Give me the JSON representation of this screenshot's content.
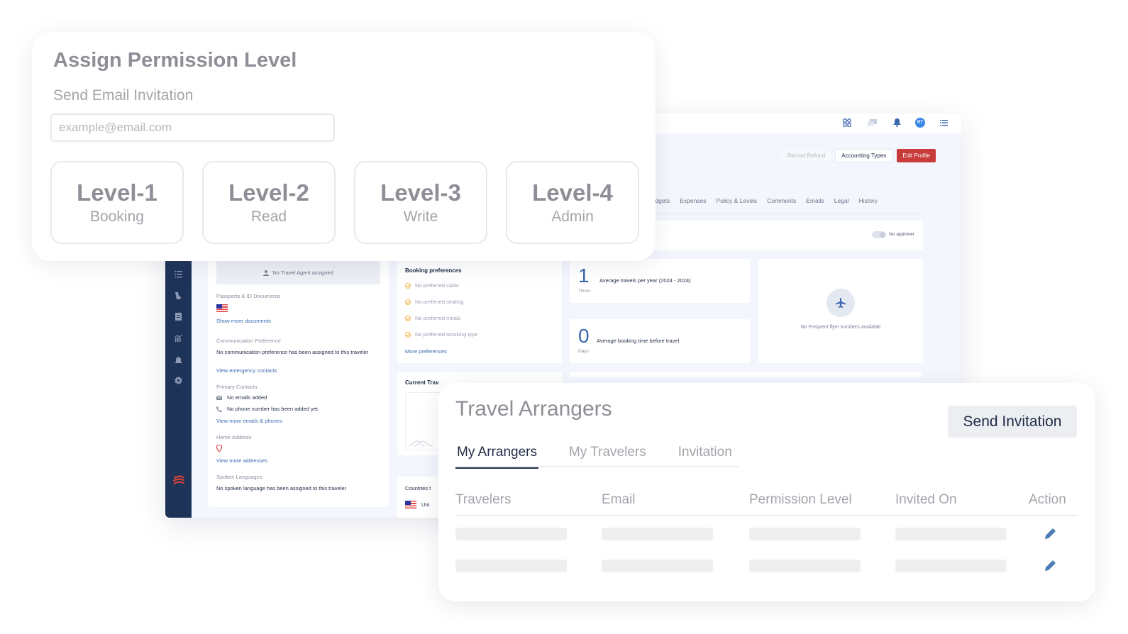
{
  "dashboard": {
    "topbar_icons": [
      "apps-grid-icon",
      "chat-icon",
      "bell-icon",
      "avatar",
      "menu-list-icon"
    ],
    "avatar_initials": "RT",
    "buttons": {
      "record_refund": "Record Refund",
      "accounting_types": "Accounting Types",
      "edit_profile": "Edit Profile"
    },
    "tabs": [
      "Budgets",
      "Expenses",
      "Policy & Levels",
      "Comments",
      "Emails",
      "Legal",
      "History"
    ],
    "approver_label": "No approver",
    "sidebar_icons": [
      "policy-icon",
      "checklist-icon",
      "booking-icon",
      "invoice-icon",
      "analytics-icon",
      "alert-icon",
      "settings-icon"
    ],
    "profile": {
      "travel_agent": "No Travel Agent assigned",
      "passports_label": "Passports & ID Documents",
      "show_more_documents": "Show more documents",
      "communication_label": "Communication Preference",
      "communication_text": "No communication preference has been assigned to this traveler",
      "emergency_link": "View emergency contacts",
      "primary_contacts_label": "Primary Contacts",
      "no_emails": "No emails added",
      "no_phone": "No phone number has been added yet.",
      "view_emails_phones": "View more emails & phones",
      "home_address_label": "Home Address",
      "view_addresses": "View more addresses",
      "spoken_languages_label": "Spoken Languages",
      "spoken_languages_text": "No spoken language has been assigned to this traveler"
    },
    "booking_preferences": {
      "title": "Booking preferences",
      "items": [
        "No preferred cabin",
        "No preferred seating",
        "No preferred meals",
        "No preferred smoking type"
      ],
      "more_link": "More preferences"
    },
    "stats": [
      {
        "value": "1",
        "unit": "Times",
        "label": "Average travels per year (2024 - 2024)"
      },
      {
        "value": "0",
        "unit": "Days",
        "label": "Average booking time before travel"
      }
    ],
    "frequent_flyer_text": "No Frequent flyer numbers available",
    "current_travels_title": "Current Trav",
    "countries_title": "Countries t",
    "countries_item": "Uni"
  },
  "permission_panel": {
    "title": "Assign Permission Level",
    "subtitle": "Send Email Invitation",
    "email_placeholder": "example@email.com",
    "email_value": "",
    "levels": [
      {
        "name": "Level-1",
        "desc": "Booking"
      },
      {
        "name": "Level-2",
        "desc": "Read"
      },
      {
        "name": "Level-3",
        "desc": "Write"
      },
      {
        "name": "Level-4",
        "desc": "Admin"
      }
    ]
  },
  "arrangers_panel": {
    "title": "Travel Arrangers",
    "send_invitation": "Send Invitation",
    "tabs": [
      {
        "label": "My Arrangers",
        "active": true
      },
      {
        "label": "My Travelers",
        "active": false
      },
      {
        "label": "Invitation",
        "active": false
      }
    ],
    "columns": [
      "Travelers",
      "Email",
      "Permission Level",
      "Invited On",
      "Action"
    ],
    "rows": [
      {
        "loading": true,
        "action_icon": "edit-pencil-icon"
      },
      {
        "loading": true,
        "action_icon": "edit-pencil-icon"
      }
    ]
  },
  "colors": {
    "brand_navy": "#1e3358",
    "edit_red": "#c73b3b",
    "link_blue": "#3b67ad",
    "pencil_blue": "#4f7bb8",
    "check_orange": "#f2b54a"
  }
}
